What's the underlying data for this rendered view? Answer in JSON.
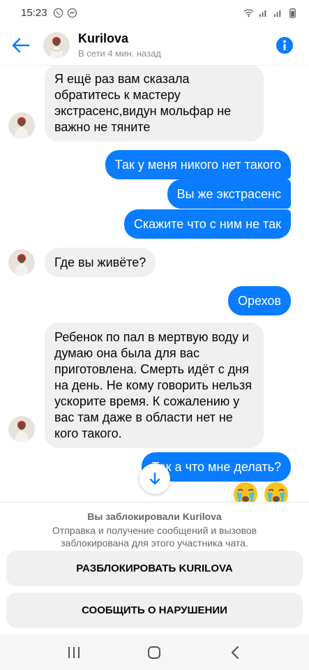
{
  "status_bar": {
    "time": "15:23"
  },
  "header": {
    "contact_name": "Kurilova",
    "contact_status": "В сети 4 мин. назад",
    "accent": "#0a7cff"
  },
  "messages": [
    {
      "side": "in",
      "text": "Я ещё раз вам сказала обратитесь к мастеру экстрасенс,видун мольфар не важно не тяните"
    },
    {
      "side": "out",
      "text": "Так у меня никого нет такого"
    },
    {
      "side": "out",
      "text": "Вы же экстрасенс"
    },
    {
      "side": "out",
      "text": "Скажите что с ним не так"
    },
    {
      "side": "in",
      "text": "Где вы живёте?"
    },
    {
      "side": "out",
      "text": "Орехов"
    },
    {
      "side": "in",
      "text": "Ребенок по пал в мертвую воду и думаю она была для вас приготовлена. Смерть идёт с дня на день. Не кому говорить нельзя ускорите время. К сожалению у вас там даже в области нет не кого такого."
    },
    {
      "side": "out",
      "text": "Так а что мне делать?"
    }
  ],
  "reactions": [
    "crying-face-emoji",
    "crying-face-emoji"
  ],
  "block_panel": {
    "title": "Вы заблокировали Kurilova",
    "description": "Отправка и получение сообщений и вызовов заблокирована для этого участника чата.",
    "unblock_label": "РАЗБЛОКИРОВАТЬ KURILOVA",
    "report_label": "СООБЩИТЬ О НАРУШЕНИИ"
  },
  "colors": {
    "outgoing_bubble": "#0a7cff",
    "incoming_bubble": "#f0f0f0",
    "secondary_text": "#65676b"
  }
}
